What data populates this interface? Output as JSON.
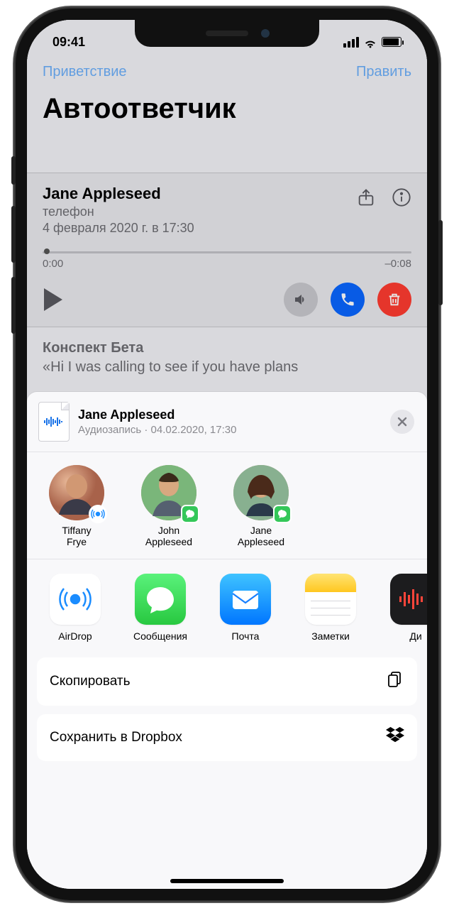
{
  "statusbar": {
    "time": "09:41"
  },
  "nav": {
    "left": "Приветствие",
    "right": "Править",
    "title": "Автоответчик"
  },
  "voicemail": {
    "name": "Jane Appleseed",
    "label": "телефон",
    "date": "4 февраля 2020 г. в 17:30",
    "elapsed": "0:00",
    "remaining": "–0:08",
    "transcript_title": "Конспект Бета",
    "transcript_text": "«Hi I was calling to see if you have plans"
  },
  "share": {
    "title": "Jane Appleseed",
    "subtitle": "Аудиозапись · 04.02.2020, 17:30",
    "contacts": [
      {
        "name_line1": "Tiffany",
        "name_line2": "Frye",
        "badge": "airdrop"
      },
      {
        "name_line1": "John",
        "name_line2": "Appleseed",
        "badge": "msg"
      },
      {
        "name_line1": "Jane",
        "name_line2": "Appleseed",
        "badge": "msg"
      }
    ],
    "apps": [
      {
        "label": "AirDrop"
      },
      {
        "label": "Сообщения"
      },
      {
        "label": "Почта"
      },
      {
        "label": "Заметки"
      },
      {
        "label": "Ди"
      }
    ],
    "actions": [
      {
        "label": "Скопировать",
        "icon": "copy"
      },
      {
        "label": "Сохранить в Dropbox",
        "icon": "dropbox"
      }
    ]
  }
}
